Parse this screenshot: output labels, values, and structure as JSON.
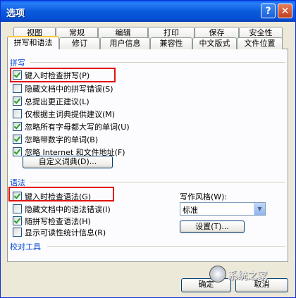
{
  "window": {
    "title": "选项"
  },
  "titlebar": {
    "help_glyph": "?",
    "close_glyph": "✕"
  },
  "tabs_back": [
    "视图",
    "常规",
    "编辑",
    "打印",
    "保存",
    "安全性"
  ],
  "tabs_front": [
    "拼写和语法",
    "修订",
    "用户信息",
    "兼容性",
    "中文版式",
    "文件位置"
  ],
  "active_tab": "拼写和语法",
  "spelling": {
    "section_label": "拼写",
    "options": [
      {
        "label": "键入时检查拼写(P)",
        "checked": true,
        "disabled": false
      },
      {
        "label": "隐藏文档中的拼写错误(S)",
        "checked": false,
        "disabled": false
      },
      {
        "label": "总提出更正建议(L)",
        "checked": true,
        "disabled": false
      },
      {
        "label": "仅根据主词典提供建议(M)",
        "checked": false,
        "disabled": false
      },
      {
        "label": "忽略所有字母都大写的单词(U)",
        "checked": true,
        "disabled": false
      },
      {
        "label": "忽略带数字的单词(B)",
        "checked": true,
        "disabled": false
      },
      {
        "label": "忽略 Internet 和文件地址(F)",
        "checked": true,
        "disabled": false
      }
    ],
    "custom_dict_button": "自定义词典(D)..."
  },
  "grammar": {
    "section_label": "语法",
    "options": [
      {
        "label": "键入时检查语法(G)",
        "checked": true,
        "disabled": false
      },
      {
        "label": "隐藏文档中的语法错误(I)",
        "checked": false,
        "disabled": false
      },
      {
        "label": "随拼写检查语法(H)",
        "checked": true,
        "disabled": false
      },
      {
        "label": "显示可读性统计信息(R)",
        "checked": false,
        "disabled": false
      }
    ],
    "style_label": "写作风格(W):",
    "style_value": "标准",
    "settings_button": "设置(T)..."
  },
  "proofing": {
    "section_label": "校对工具"
  },
  "footer": {
    "ok_button": "确定",
    "cancel_button": "取消"
  },
  "watermark": {
    "text": "系统之家"
  },
  "colors": {
    "title_bar": "#0b5bdc",
    "highlight_box": "#e3120c",
    "section_label": "#0046d5"
  }
}
